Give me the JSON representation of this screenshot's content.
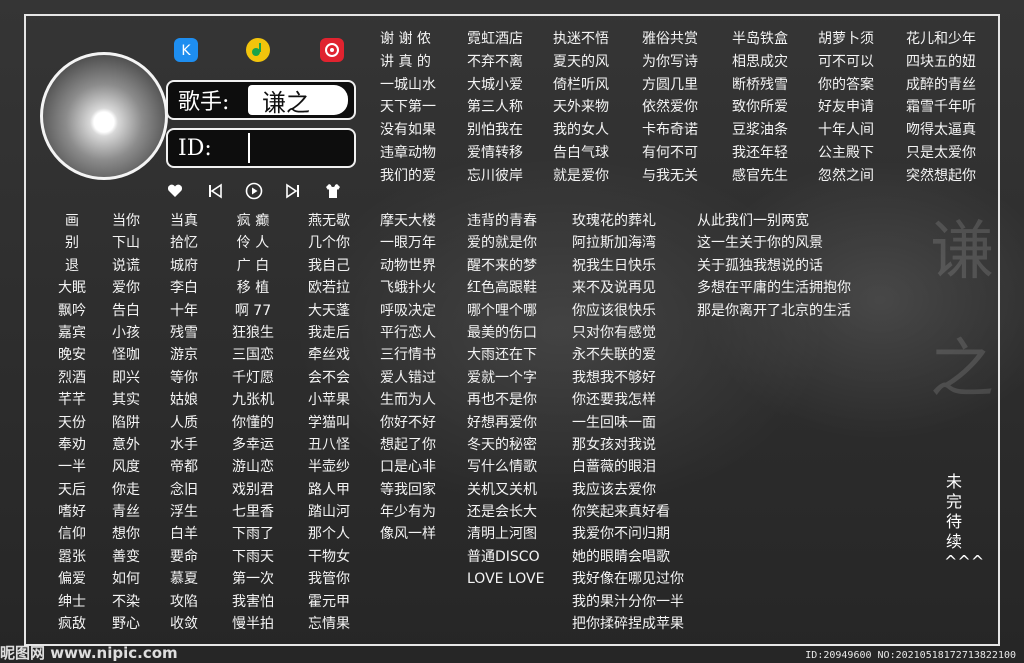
{
  "singer": {
    "label": "歌手:",
    "name": "谦之",
    "id_label": "ID:",
    "id_value": ""
  },
  "apps": [
    {
      "icon": "kugou-icon",
      "color": "#1e8ef0"
    },
    {
      "icon": "qqmusic-icon",
      "color": "#f2c40c"
    },
    {
      "icon": "netease-icon",
      "color": "#e0232f"
    }
  ],
  "controls": [
    "heart-icon",
    "previous-icon",
    "play-icon",
    "next-icon",
    "shirt-icon"
  ],
  "left_columns": [
    [
      "画",
      "别",
      "退",
      "大眠",
      "飘吟",
      "嘉宾",
      "晚安",
      "烈酒",
      "芊芊",
      "天份",
      "奉劝",
      "一半",
      "天后",
      "嗜好",
      "信仰",
      "嚣张",
      "偏爱",
      "绅士",
      "疯敌"
    ],
    [
      "当你",
      "下山",
      "说谎",
      "爱你",
      "告白",
      "小孩",
      "怪咖",
      "即兴",
      "其实",
      "陷阱",
      "意外",
      "风度",
      "你走",
      "青丝",
      "想你",
      "善变",
      "如何",
      "不染",
      "野心"
    ],
    [
      "当真",
      "拾忆",
      "城府",
      "李白",
      "十年",
      "残雪",
      "游京",
      "等你",
      "姑娘",
      "人质",
      "水手",
      "帝都",
      "念旧",
      "浮生",
      "白羊",
      "要命",
      "慕夏",
      "攻陷",
      "收敛"
    ],
    [
      "疯  癫",
      "伶  人",
      "广  白",
      "移  植",
      "啊  77",
      "狂狼生",
      "三国恋",
      "千灯愿",
      "九张机",
      "你懂的",
      "多幸运",
      "游山恋",
      "戏别君",
      "七里香",
      "下雨了",
      "下雨天",
      "第一次",
      "我害怕",
      "慢半拍"
    ],
    [
      "燕无歇",
      "几个你",
      "我自己",
      "欧若拉",
      "大天蓬",
      "我走后",
      "牵丝戏",
      "会不会",
      "小苹果",
      "学猫叫",
      "丑八怪",
      "半壶纱",
      "路人甲",
      "踏山河",
      "那个人",
      "干物女",
      "我管你",
      "霍元甲",
      "忘情果"
    ]
  ],
  "top_columns": [
    [
      "谢 谢 侬",
      "讲 真 的",
      "一城山水",
      "天下第一",
      "没有如果",
      "违章动物",
      "我们的爱"
    ],
    [
      "霓虹酒店",
      "不弃不离",
      "大城小爱",
      "第三人称",
      "别怕我在",
      "爱情转移",
      "忘川彼岸"
    ],
    [
      "执迷不悟",
      "夏天的风",
      "倚栏听风",
      "天外来物",
      "我的女人",
      "告白气球",
      "就是爱你"
    ],
    [
      "雅俗共赏",
      "为你写诗",
      "方圆几里",
      "依然爱你",
      "卡布奇诺",
      "有何不可",
      "与我无关"
    ],
    [
      "半岛铁盒",
      "相思成灾",
      "断桥残雪",
      "致你所爱",
      "豆浆油条",
      "我还年轻",
      "感官先生"
    ],
    [
      "胡萝卜须",
      "可不可以",
      "你的答案",
      "好友申请",
      "十年人间",
      "公主殿下",
      "忽然之间"
    ],
    [
      "花儿和少年",
      "四块五的妞",
      "成醉的青丝",
      "霜雪千年听",
      "吻得太逼真",
      "只是太爱你",
      "突然想起你"
    ]
  ],
  "mid_columns": [
    [
      "摩天大楼",
      "一眼万年",
      "动物世界",
      "飞蛾扑火",
      "呼吸决定",
      "平行恋人",
      "三行情书",
      "爱人错过",
      "生而为人",
      "你好不好",
      "想起了你",
      "口是心非",
      "等我回家",
      "年少有为",
      "像风一样"
    ],
    [
      "违背的青春",
      "爱的就是你",
      "醒不来的梦",
      "红色高跟鞋",
      "哪个哩个哪",
      "最美的伤口",
      "大雨还在下",
      "爱就一个字",
      "再也不是你",
      "好想再爱你",
      "冬天的秘密",
      "写什么情歌",
      "关机又关机",
      "还是会长大",
      "清明上河图",
      "普通DISCO",
      "LOVE LOVE"
    ],
    [
      "玫瑰花的葬礼",
      "阿拉斯加海湾",
      "祝我生日快乐",
      "来不及说再见",
      "你应该很快乐",
      "只对你有感觉",
      "永不失联的爱",
      "我想我不够好",
      "你还要我怎样",
      "一生回味一面",
      "那女孩对我说",
      "白蔷薇的眼泪",
      "我应该去爱你",
      "你笑起来真好看",
      "我爱你不问归期",
      "她的眼睛会唱歌",
      "我好像在哪见过你",
      "我的果汁分你一半",
      "把你揉碎捏成苹果"
    ],
    [
      "从此我们一别两宽",
      "这一生关于你的风景",
      "关于孤独我想说的话",
      "多想在平庸的生活拥抱你",
      "那是你离开了北京的生活"
    ]
  ],
  "pending_label": "未完待续^^^",
  "watermark": [
    "谦",
    "之"
  ],
  "footer": {
    "site": "昵图网 www.nipic.com",
    "id_line": "ID:20949600 NO:20210518172713822100"
  }
}
